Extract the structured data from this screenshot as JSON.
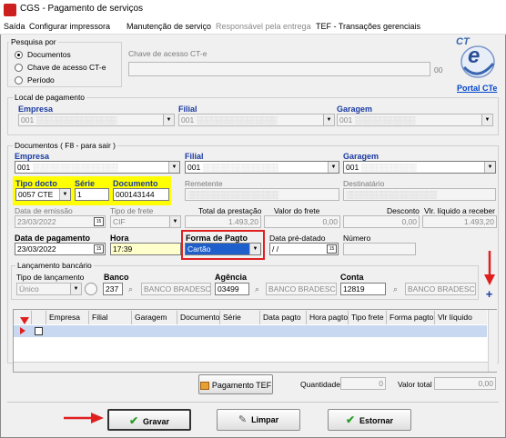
{
  "window": {
    "title": "CGS - Pagamento de serviços"
  },
  "menu": [
    "Saída",
    "Configurar impressora",
    "Manutenção de serviço",
    "Responsável pela entrega",
    "TEF - Transações gerenciais"
  ],
  "search": {
    "group_label": "Pesquisa por",
    "options": [
      "Documentos",
      "Chave de acesso CT-e",
      "Período"
    ],
    "selected": "Documentos",
    "key_label": "Chave de acesso CT-e",
    "key_suffix": "00",
    "logo_text": "CT",
    "logo_e": "e",
    "portal_link": "Portal CTe"
  },
  "payment_place": {
    "group_label": "Local de pagamento",
    "empresa_label": "Empresa",
    "filial_label": "Filial",
    "garagem_label": "Garagem",
    "empresa_value": "001",
    "filial_value": "001",
    "garagem_value": "001"
  },
  "documents": {
    "group_label": "Documentos ( F8 - para sair )",
    "empresa_label": "Empresa",
    "filial_label": "Filial",
    "garagem_label": "Garagem",
    "empresa_value": "001",
    "filial_value": "001",
    "garagem_value": "001",
    "tipo_docto_label": "Tipo docto",
    "serie_label": "Série",
    "documento_label": "Documento",
    "tipo_docto_value": "0057 CTE",
    "serie_value": "1",
    "documento_value": "000143144",
    "remetente_label": "Remetente",
    "destinatario_label": "Destinatário",
    "data_emissao_label": "Data de emissão",
    "data_emissao_value": "23/03/2022",
    "tipo_frete_label": "Tipo de frete",
    "tipo_frete_value": "CIF",
    "total_prestacao_label": "Total da prestação",
    "total_prestacao_value": "1.493,20",
    "valor_frete_label": "Valor do frete",
    "valor_frete_value": "0,00",
    "desconto_label": "Desconto",
    "desconto_value": "0,00",
    "vlr_liquido_label": "Vlr. líquido a receber",
    "vlr_liquido_value": "1.493,20",
    "data_pagamento_label": "Data de pagamento",
    "data_pagamento_value": "23/03/2022",
    "hora_label": "Hora",
    "hora_value": "17:39",
    "forma_pagto_label": "Forma de Pagto",
    "forma_pagto_value": "Cartão",
    "data_predatado_label": "Data pré-datado",
    "data_predatado_value": "/ /",
    "numero_label": "Número"
  },
  "bank": {
    "group_label": "Lançamento bancário",
    "tipo_label": "Tipo de lançamento",
    "tipo_value": "Único",
    "banco_label": "Banco",
    "banco_code": "237",
    "banco_name": "BANCO BRADESCO",
    "agencia_label": "Agência",
    "agencia_code": "03499",
    "agencia_name": "BANCO BRADESCO",
    "conta_label": "Conta",
    "conta_code": "12819",
    "conta_name": "BANCO BRADESCO",
    "add_label": "+"
  },
  "grid": {
    "columns": [
      "Empresa",
      "Filial",
      "Garagem",
      "Documento",
      "Série",
      "Data pagto",
      "Hora pagto",
      "Tipo frete",
      "Forma pagto",
      "Vlr líquido"
    ]
  },
  "footer": {
    "pagamento_tef": "Pagamento TEF",
    "quantidade_label": "Quantidade",
    "quantidade_value": "0",
    "valor_total_label": "Valor total",
    "valor_total_value": "0,00",
    "gravar": "Gravar",
    "limpar": "Limpar",
    "estornar": "Estornar"
  },
  "colors": {
    "highlight": "#ffff00",
    "annotation": "#e02020",
    "link": "#0044cc",
    "selection": "#1e5fcc",
    "grid_row": "#c8d8f0"
  }
}
